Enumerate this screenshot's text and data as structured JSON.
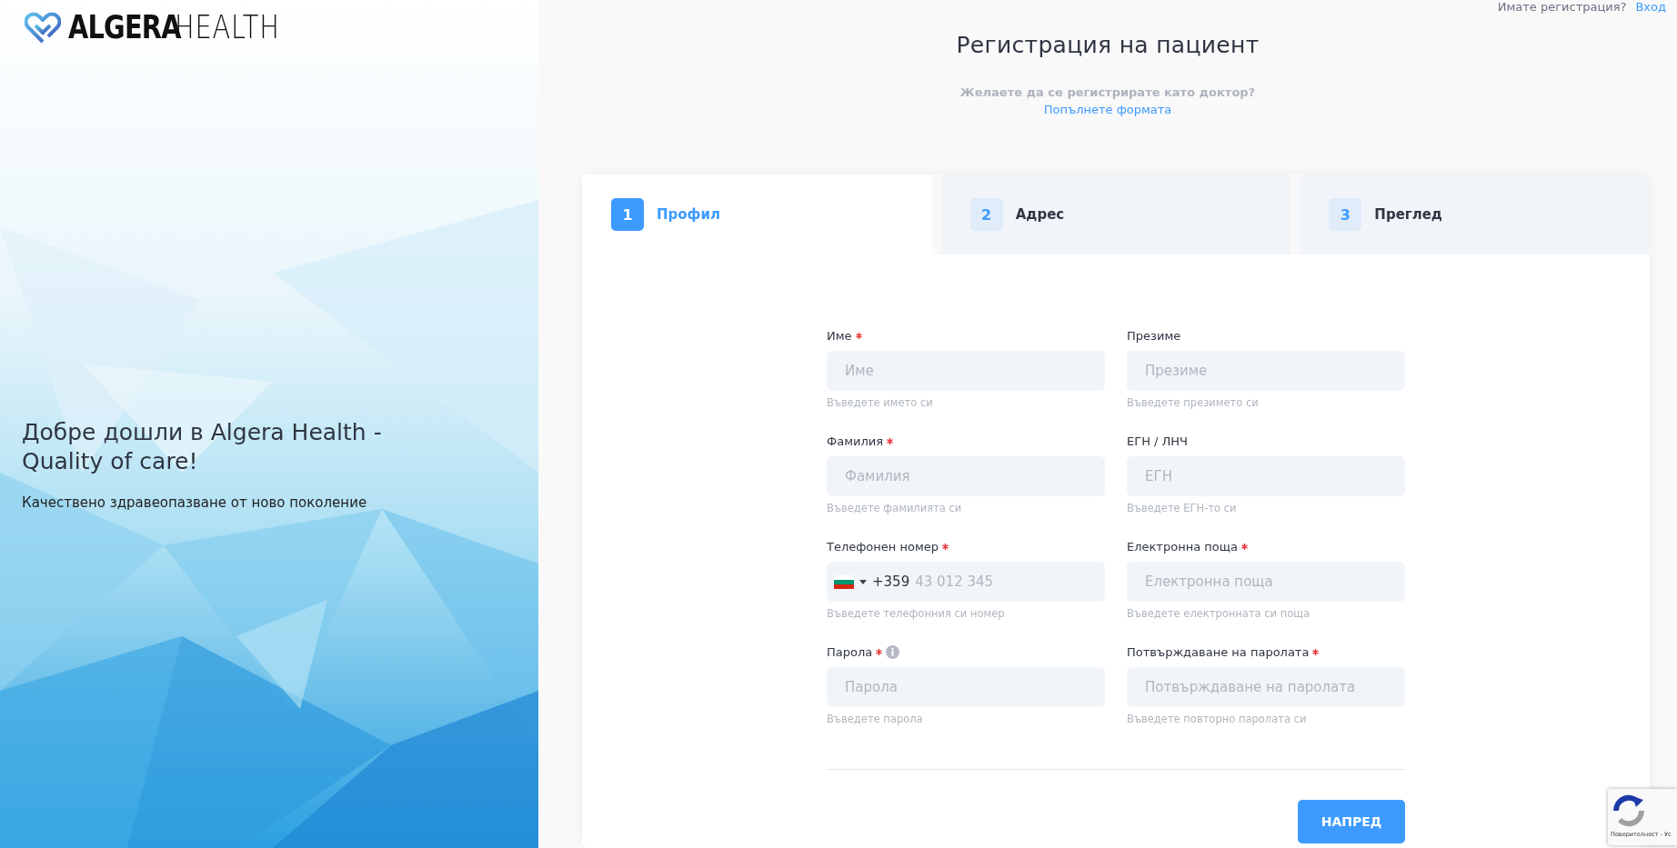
{
  "logo": {
    "bold": "ALGERA",
    "light": "HEALTH"
  },
  "hero": {
    "kind": "picture",
    "heading": "Добре дошли в Algera Health - Quality of care!",
    "subheading": "Качествено здравеопазване от ново поколение"
  },
  "header": {
    "question": "Имате регистрация?",
    "login_link": "Вход"
  },
  "title": "Регистрация на пациент",
  "doctor_prompt": {
    "question": "Желаете да се регистрирате като доктор?",
    "link": "Попълнете формата"
  },
  "tabs": [
    {
      "number": "1",
      "label": "Профил",
      "selected": true
    },
    {
      "number": "2",
      "label": "Адрес",
      "selected": false
    },
    {
      "number": "3",
      "label": "Преглед",
      "selected": false
    }
  ],
  "fields": [
    {
      "kind": "text",
      "label": "Име",
      "required": true,
      "info": false,
      "placeholder": "Име",
      "hint": "Въведете името си"
    },
    {
      "kind": "text",
      "label": "Презиме",
      "required": false,
      "info": false,
      "placeholder": "Презиме",
      "hint": "Въведете презимето си"
    },
    {
      "kind": "text",
      "label": "Фамилия",
      "required": true,
      "info": false,
      "placeholder": "Фамилия",
      "hint": "Въведете фамилията си"
    },
    {
      "kind": "text",
      "label": "ЕГН / ЛНЧ",
      "required": false,
      "info": false,
      "placeholder": "ЕГН",
      "hint": "Въведете ЕГН-то си"
    },
    {
      "kind": "phone",
      "label": "Телефонен номер",
      "required": true,
      "info": false,
      "dial_code": "+359",
      "placeholder": "43 012 345",
      "hint": "Въведете телефонния си номер"
    },
    {
      "kind": "text",
      "label": "Електронна поща",
      "required": true,
      "info": false,
      "placeholder": "Електронна поща",
      "hint": "Въведете електронната си поща"
    },
    {
      "kind": "password",
      "label": "Парола",
      "required": true,
      "info": true,
      "placeholder": "Парола",
      "hint": "Въведете парола"
    },
    {
      "kind": "password",
      "label": "Потвърждаване на паролата",
      "required": true,
      "info": false,
      "placeholder": "Потвърждаване на паролата",
      "hint": "Въведете повторно паролата си"
    }
  ],
  "next_button": "НАПРЕД",
  "recaptcha": {
    "text": "Поверителност - Ус"
  }
}
